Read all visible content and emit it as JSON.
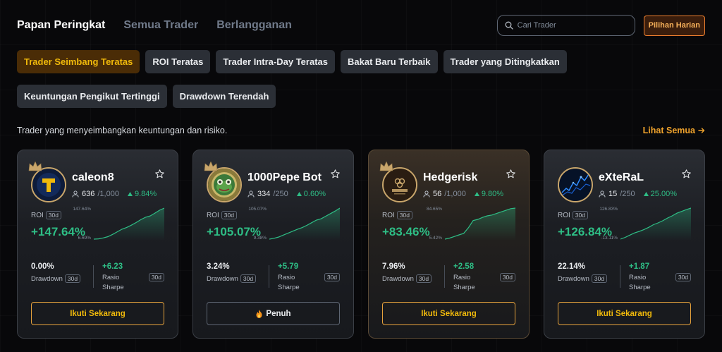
{
  "tabs": [
    {
      "label": "Papan Peringkat",
      "active": true
    },
    {
      "label": "Semua Trader",
      "active": false
    },
    {
      "label": "Berlangganan",
      "active": false
    }
  ],
  "search": {
    "placeholder": "Cari Trader"
  },
  "daily_label": "Pilihan Harian",
  "chips": [
    {
      "label": "Trader Seimbang Teratas",
      "active": true
    },
    {
      "label": "ROI Teratas",
      "active": false
    },
    {
      "label": "Trader Intra-Day Teratas",
      "active": false
    },
    {
      "label": "Bakat Baru Terbaik",
      "active": false
    },
    {
      "label": "Trader yang Ditingkatkan",
      "active": false
    },
    {
      "label": "Keuntungan Pengikut Tertinggi",
      "active": false
    },
    {
      "label": "Drawdown Terendah",
      "active": false
    }
  ],
  "description": "Trader yang menyeimbangkan keuntungan dan risiko.",
  "see_all": "Lihat Semua",
  "labels": {
    "roi": "ROI",
    "period": "30d",
    "drawdown": "Drawdown",
    "sharpe_line1": "Rasio",
    "sharpe_line2": "Sharpe"
  },
  "colors": {
    "green": "#2ebd85",
    "accent": "#f0b90b",
    "orange": "#f0812f"
  },
  "traders": [
    {
      "name": "caleon8",
      "avatar_icon": "t-logo-icon",
      "crowned": true,
      "followers": "636",
      "capacity": "/1,000",
      "change": "9.84%",
      "roi": "+147.64%",
      "roi_max": "147.64%",
      "roi_min": "6.69%",
      "series": [
        6.69,
        8,
        12,
        18,
        28,
        40,
        52,
        60,
        70,
        82,
        95,
        106,
        112,
        125,
        138,
        147.64
      ],
      "drawdown": "0.00%",
      "sharpe": "+6.23",
      "action": "Ikuti Sekarang",
      "action_full": false
    },
    {
      "name": "1000Pepe Bot",
      "avatar_icon": "frog-coin-icon",
      "crowned": true,
      "followers": "334",
      "capacity": "/250",
      "change": "0.60%",
      "roi": "+105.07%",
      "roi_max": "105.07%",
      "roi_min": "9.38%",
      "series": [
        9.38,
        12,
        16,
        22,
        28,
        34,
        40,
        45,
        52,
        60,
        68,
        72,
        80,
        88,
        96,
        105.07
      ],
      "drawdown": "3.24%",
      "sharpe": "+5.79",
      "action": "Penuh",
      "action_full": true
    },
    {
      "name": "Hedgerisk",
      "avatar_icon": "hedge-logo-icon",
      "crowned": true,
      "followers": "56",
      "capacity": "/1,000",
      "change": "9.80%",
      "roi": "+83.46%",
      "roi_max": "84.65%",
      "roi_min": "5.42%",
      "series": [
        5.42,
        8,
        12,
        16,
        20,
        34,
        52,
        55,
        60,
        64,
        66,
        70,
        74,
        78,
        82,
        83.46
      ],
      "drawdown": "7.96%",
      "sharpe": "+2.58",
      "action": "Ikuti Sekarang",
      "action_full": false
    },
    {
      "name": "eXteRaL",
      "avatar_icon": "blue-chart-avatar-icon",
      "crowned": false,
      "followers": "15",
      "capacity": "/250",
      "change": "25.00%",
      "roi": "+126.84%",
      "roi_max": "126.83%",
      "roi_min": "-13.11%",
      "series": [
        -13.11,
        -5,
        5,
        15,
        22,
        30,
        40,
        52,
        60,
        70,
        82,
        92,
        104,
        112,
        120,
        126.84
      ],
      "drawdown": "22.14%",
      "sharpe": "+1.87",
      "action": "Ikuti Sekarang",
      "action_full": false
    }
  ]
}
